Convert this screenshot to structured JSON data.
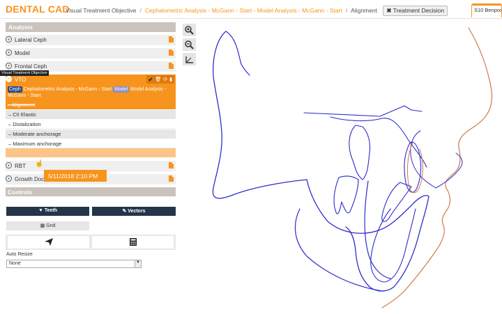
{
  "app": {
    "logo": "DENTAL CAD"
  },
  "breadcrumb": {
    "items": [
      "Visual Treatment Objective",
      "Cephalometric Analysis - McGann - Start - Model Analysis - McGann - Start",
      "Alignment"
    ],
    "treatment_decision_label": "Treatment Decision",
    "treatment_decision_icon": "close-icon"
  },
  "top_tab": {
    "label": "S10 Benpos"
  },
  "analysis": {
    "title": "Analysis",
    "rows": [
      {
        "label": "Lateral Ceph"
      },
      {
        "label": "Model"
      },
      {
        "label": "Frontal Ceph"
      }
    ],
    "tooltip": "Visual Treatment Objective",
    "vto": {
      "label": "VTO",
      "ceph_tag": "Ceph",
      "ceph_text": "Cephalometric Analysis - McGann - Start",
      "model_tag": "Model",
      "model_text": "Model Analysis - McGann - Start",
      "alignment_label": "Alignment",
      "options": [
        {
          "type": "header",
          "label": "CII Elastic"
        },
        {
          "type": "option",
          "label": "Distalization"
        },
        {
          "type": "header",
          "label": "Moderate anchorage"
        },
        {
          "type": "option",
          "label": "Maximum anchorage"
        }
      ],
      "date_tooltip": "5/11/2018 2:10 PM"
    },
    "rows_after": [
      {
        "label": "RBT"
      },
      {
        "label": "Growth Doc"
      }
    ]
  },
  "controls": {
    "title": "Controls",
    "teeth_label": "Teeth",
    "vectors_label": "Vectors",
    "grid_label": "Grid",
    "send_icon": "send-icon",
    "calculator_icon": "calculator-icon",
    "autoresize_label": "Auto Resize",
    "autoresize_value": "None"
  },
  "tools": [
    "zoom-in-icon",
    "zoom-out-icon",
    "measure-icon"
  ],
  "colors": {
    "accent": "#f7941d",
    "dark_button": "#24354a",
    "tracing_blue": "#2c2ccc",
    "tracing_orange": "#d07848"
  }
}
